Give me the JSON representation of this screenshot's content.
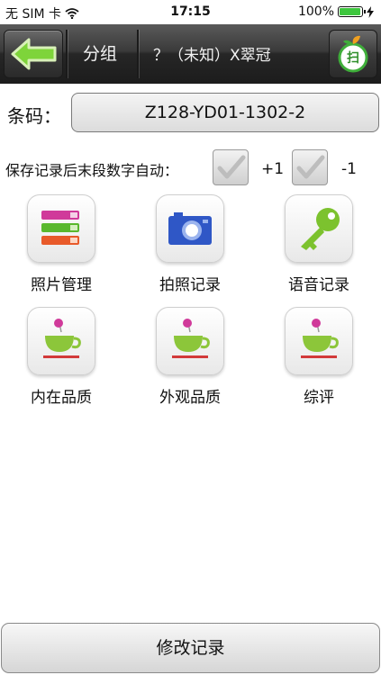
{
  "status_bar": {
    "carrier": "无 SIM 卡",
    "time": "17:15",
    "battery": "100%",
    "battery_level": 1.0
  },
  "nav": {
    "back_icon": "back-arrow-icon",
    "group_label": "分组",
    "title": "？（未知）X翠冠",
    "scan_icon": "scan-icon",
    "scan_label": "扫"
  },
  "form": {
    "barcode_label": "条码：",
    "barcode_value": "Z128-YD01-1302-2",
    "auto_label": "保存记录后末段数字自动：",
    "plus_label": "+1",
    "minus_label": "-1"
  },
  "actions": [
    {
      "label": "照片管理",
      "icon": "photo-manage-icon"
    },
    {
      "label": "拍照记录",
      "icon": "camera-icon"
    },
    {
      "label": "语音记录",
      "icon": "key-icon"
    },
    {
      "label": "内在品质",
      "icon": "tea-cup-icon"
    },
    {
      "label": "外观品质",
      "icon": "tea-cup-icon"
    },
    {
      "label": "综评",
      "icon": "tea-cup-icon"
    }
  ],
  "bottom": {
    "button_label": "修改记录"
  }
}
